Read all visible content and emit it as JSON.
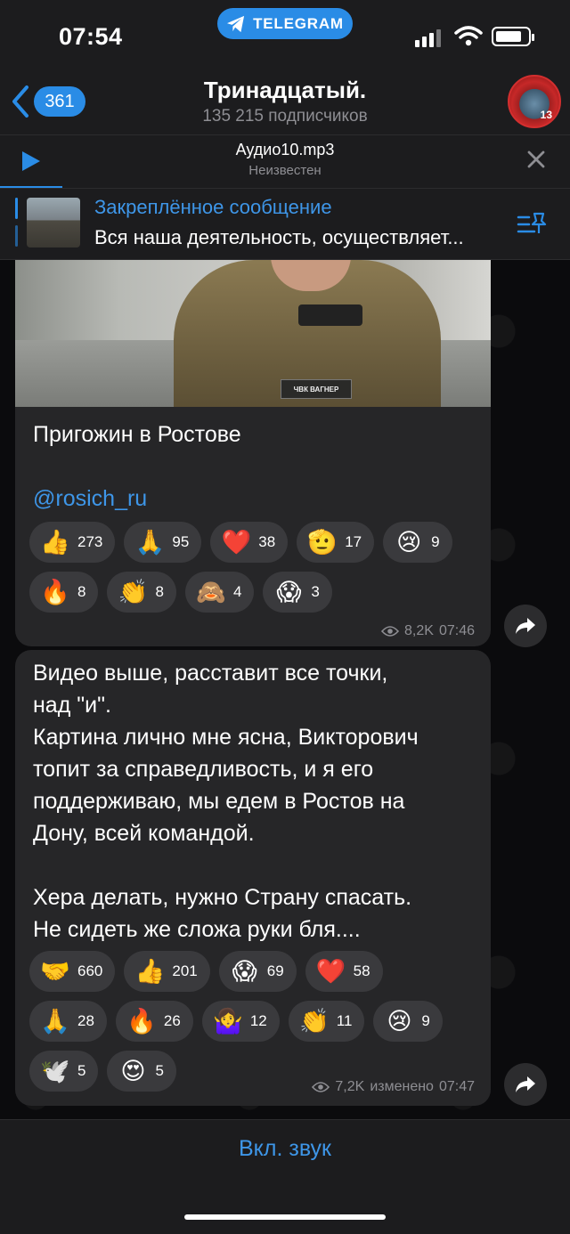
{
  "status_bar": {
    "time": "07:54",
    "app_pill": "TELEGRAM"
  },
  "header": {
    "back_count": "361",
    "title": "Тринадцатый.",
    "subtitle": "135 215 подписчиков",
    "avatar_badge": "13"
  },
  "audio_player": {
    "title": "Аудио10.mp3",
    "artist": "Неизвестен"
  },
  "pinned": {
    "title": "Закреплённое сообщение",
    "text": "Вся наша деятельность, осуществляет..."
  },
  "messages": [
    {
      "photo_patch": "ЧВК ВАГНЕР",
      "text": "Пригожин в Ростове",
      "link": "@rosich_ru",
      "reactions": [
        {
          "emoji": "👍",
          "count": "273"
        },
        {
          "emoji": "🙏",
          "count": "95"
        },
        {
          "emoji": "❤️",
          "count": "38"
        },
        {
          "emoji": "🫡",
          "count": "17"
        },
        {
          "emoji": "😢",
          "count": "9"
        },
        {
          "emoji": "🔥",
          "count": "8"
        },
        {
          "emoji": "👏",
          "count": "8"
        },
        {
          "emoji": "🙈",
          "count": "4"
        },
        {
          "emoji": "😱",
          "count": "3"
        }
      ],
      "views": "8,2K",
      "time": "07:46"
    },
    {
      "lines": [
        "Видео выше, расставит все точки,",
        "над \"и\".",
        "Картина лично мне ясна, Викторович",
        "топит за справедливость, и я его",
        "поддерживаю, мы едем в Ростов на",
        "Дону, всей командой.",
        "",
        "Хера делать, нужно Страну спасать.",
        "Не сидеть же сложа руки бля...."
      ],
      "reactions": [
        {
          "emoji": "🤝",
          "count": "660"
        },
        {
          "emoji": "👍",
          "count": "201"
        },
        {
          "emoji": "😱",
          "count": "69"
        },
        {
          "emoji": "❤️",
          "count": "58"
        },
        {
          "emoji": "🙏",
          "count": "28"
        },
        {
          "emoji": "🔥",
          "count": "26"
        },
        {
          "emoji": "🤷‍♀️",
          "count": "12"
        },
        {
          "emoji": "👏",
          "count": "11"
        },
        {
          "emoji": "😢",
          "count": "9"
        },
        {
          "emoji": "🕊️",
          "count": "5"
        },
        {
          "emoji": "😍",
          "count": "5"
        }
      ],
      "views": "7,2K",
      "edited_label": "изменено",
      "time": "07:47"
    }
  ],
  "bottom": {
    "sound_button": "Вкл. звук"
  },
  "colors": {
    "accent": "#2a8ce6",
    "link": "#3e96e8",
    "bubble": "#262628",
    "header": "#1c1c1e"
  }
}
